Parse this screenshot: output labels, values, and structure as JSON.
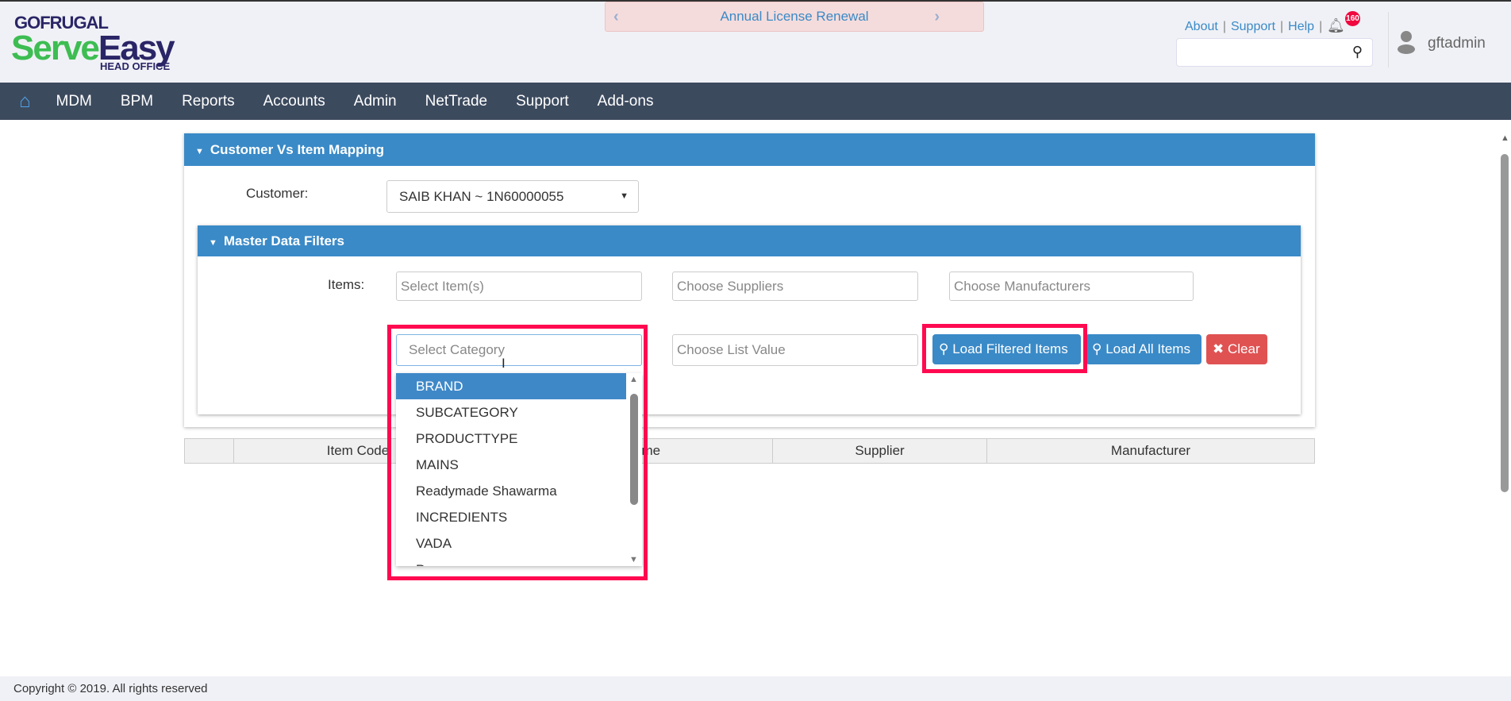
{
  "logo": {
    "brand": "GOFRUGAL",
    "product_a": "Serve",
    "product_b": "Easy",
    "sub": "HEAD OFFICE"
  },
  "banner": {
    "text": "Annual License Renewal"
  },
  "top_links": [
    "About",
    "Support",
    "Help"
  ],
  "notifications": {
    "count": "160"
  },
  "user": {
    "name": "gftadmin"
  },
  "nav": [
    "MDM",
    "BPM",
    "Reports",
    "Accounts",
    "Admin",
    "NetTrade",
    "Support",
    "Add-ons"
  ],
  "panel": {
    "title": "Customer Vs Item Mapping",
    "customer_label": "Customer:",
    "customer_value": "SAIB KHAN ~ 1N60000055"
  },
  "filters": {
    "title": "Master Data Filters",
    "items_label": "Items:",
    "ph_items": "Select Item(s)",
    "ph_suppliers": "Choose Suppliers",
    "ph_manufacturers": "Choose Manufacturers",
    "ph_category": "Select Category",
    "ph_list": "Choose List Value",
    "load_filtered": "Load Filtered Items",
    "load_all": "Load All Items",
    "clear": "Clear"
  },
  "category_options": [
    "BRAND",
    "SUBCATEGORY",
    "PRODUCTTYPE",
    "MAINS",
    "Readymade Shawarma",
    "INCREDIENTS",
    "VADA",
    "Peg"
  ],
  "table": {
    "columns": [
      "",
      "Item Code",
      "Item Name",
      "Supplier",
      "Manufacturer"
    ]
  },
  "footer": {
    "text": "Copyright © 2019. All rights reserved"
  },
  "colors": {
    "accent": "#3a8ac7",
    "nav": "#3c4a5e",
    "highlight": "#ff0a50",
    "danger": "#e05252"
  }
}
